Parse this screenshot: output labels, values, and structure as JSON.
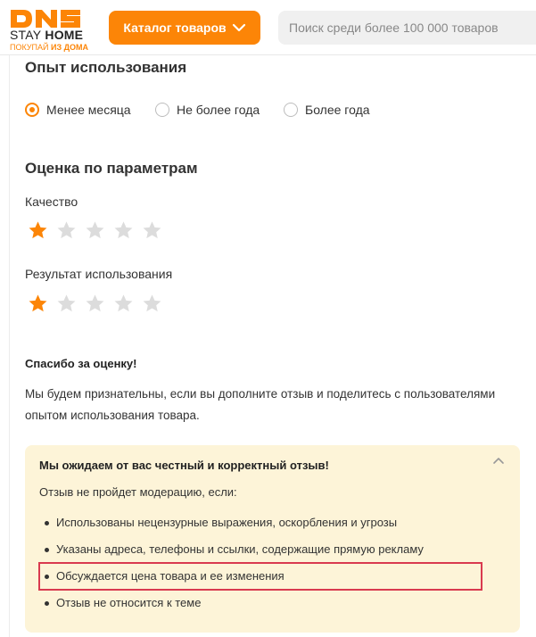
{
  "header": {
    "logo": {
      "brand": "DNS",
      "stay": "STAY",
      "home": "HOME",
      "sub_prefix": "ПОКУПАЙ",
      "sub_bold": "ИЗ ДОМА"
    },
    "catalog_button": "Каталог товаров",
    "search_placeholder": "Поиск среди более 100 000 товаров"
  },
  "experience": {
    "title": "Опыт использования",
    "options": [
      "Менее месяца",
      "Не более года",
      "Более года"
    ],
    "selected": "Менее месяца"
  },
  "rating": {
    "title": "Оценка по параметрам",
    "params": [
      {
        "label": "Качество",
        "stars": 1,
        "max": 5
      },
      {
        "label": "Результат использования",
        "stars": 1,
        "max": 5
      }
    ]
  },
  "thanks": {
    "title": "Спасибо за оценку!",
    "text": "Мы будем признательны, если вы дополните отзыв и поделитесь с пользователями опытом использования товара."
  },
  "notice": {
    "title": "Мы ожидаем от вас честный и корректный отзыв!",
    "subtitle": "Отзыв не пройдет модерацию, если:",
    "items": [
      "Использованы нецензурные выражения, оскорбления и угрозы",
      "Указаны адреса, телефоны и ссылки, содержащие прямую рекламу",
      "Обсуждается цена товара и ее изменения",
      "Отзыв не относится к теме"
    ],
    "highlighted_item": "Обсуждается цена товара и ее изменения"
  },
  "colors": {
    "accent": "#fc8507",
    "star_empty": "#dcdcdc",
    "notice_bg": "#fdf4d8",
    "highlight_border": "#d93a4f"
  }
}
